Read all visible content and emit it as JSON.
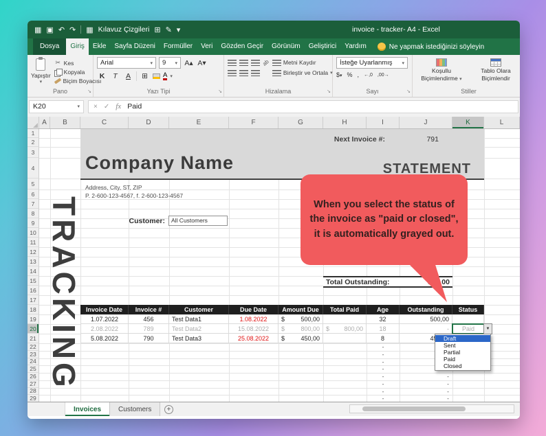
{
  "colors": {
    "accent_green": "#217346",
    "titlebar_green": "#1B5E3A",
    "callout_red": "#F15B5D",
    "overdue_red": "#E01212",
    "selection_blue": "#2C67C8",
    "grayed_text": "#ACACAC",
    "table_header_bg": "#1F1F1F"
  },
  "icons": {
    "app": "▦",
    "save": "▣",
    "undo": "↶",
    "redo": "↷",
    "gridlines": "▦",
    "table": "⊞",
    "pen": "✎",
    "dropdown": "▾",
    "dropdown_solid": "▼",
    "cut": "✂",
    "cancel": "×",
    "enter": "✓",
    "fx": "fx",
    "launcher": "↘",
    "borders": "⊞",
    "money": "$",
    "percent": "%",
    "comma": ",",
    "dec_inc": "←,0",
    "dec_dec": ",00→",
    "orient": "ab",
    "plus": "+"
  },
  "titlebar": {
    "title": "invoice - tracker- A4 - Excel",
    "gridlines_toggle": "Kılavuz Çizgileri"
  },
  "ribbon_tabs": {
    "items": [
      {
        "label": "Dosya",
        "file": true
      },
      {
        "label": "Giriş",
        "active": true
      },
      {
        "label": "Ekle"
      },
      {
        "label": "Sayfa Düzeni"
      },
      {
        "label": "Formüller"
      },
      {
        "label": "Veri"
      },
      {
        "label": "Gözden Geçir"
      },
      {
        "label": "Görünüm"
      },
      {
        "label": "Geliştirici"
      },
      {
        "label": "Yardım"
      }
    ],
    "tellme": "Ne yapmak istediğinizi söyleyin"
  },
  "ribbon": {
    "pano": {
      "paste": "Yapıştır",
      "cut": "Kes",
      "copy": "Kopyala",
      "painter": "Biçim Boyacısı",
      "label": "Pano"
    },
    "font": {
      "family": "Arial",
      "size": "9",
      "bold": "K",
      "italic": "T",
      "underline": "A",
      "color_letter": "A",
      "grow": "A▴",
      "shrink": "A▾",
      "label": "Yazı Tipi"
    },
    "alignment": {
      "wrap": "Metni Kaydır",
      "merge": "Birleştir ve Ortala",
      "label": "Hizalama"
    },
    "number": {
      "format": "İsteğe Uyarlanmış",
      "label": "Sayı"
    },
    "styles": {
      "cond_line1": "Koşullu",
      "cond_line2": "Biçimlendirme",
      "table_line1": "Tablo Olara",
      "table_line2": "Biçimlendir",
      "label": "Stiller"
    }
  },
  "formula_bar": {
    "name_box": "K20",
    "value": "Paid"
  },
  "grid": {
    "columns": [
      "A",
      "B",
      "C",
      "D",
      "E",
      "F",
      "G",
      "H",
      "I",
      "J",
      "K",
      "L"
    ],
    "rows": [
      "1",
      "2",
      "3",
      "4",
      "5",
      "6",
      "7",
      "8",
      "9",
      "10",
      "11",
      "12",
      "13",
      "14",
      "15",
      "16",
      "17",
      "18",
      "19",
      "20",
      "21",
      "22",
      "23",
      "24",
      "25",
      "26",
      "27",
      "28",
      "29"
    ],
    "selected_column": "K",
    "selected_row": "20"
  },
  "template": {
    "next_invoice_label": "Next Invoice #:",
    "next_invoice_value": "791",
    "company_name": "Company Name",
    "statement": "STATEMENT",
    "address": "Address, City, ST, ZIP",
    "phones": "P. 2-600-123-4567, f. 2-600-123-4567",
    "customer_label": "Customer:",
    "customer_value": "All Customers",
    "vertical_title": "TRACKING",
    "total_label": "Total Outstanding:",
    "total_value": "950,00",
    "currency": "$"
  },
  "invoice_table": {
    "headers": [
      "Invoice Date",
      "Invoice #",
      "Customer",
      "Due Date",
      "Amount Due",
      "Total Paid",
      "Age",
      "Outstanding",
      "Status"
    ],
    "rows": [
      {
        "date": "1.07.2022",
        "no": "456",
        "customer": "Test Data1",
        "due": "1.08.2022",
        "amount": "500,00",
        "paid": "",
        "age": "32",
        "outstanding": "500,00",
        "status": "",
        "overdue": true,
        "grayed": false
      },
      {
        "date": "2.08.2022",
        "no": "789",
        "customer": "Test Data2",
        "due": "15.08.2022",
        "amount": "800,00",
        "paid": "800,00",
        "age": "18",
        "outstanding": "-",
        "status": "Paid",
        "overdue": false,
        "grayed": true
      },
      {
        "date": "5.08.2022",
        "no": "790",
        "customer": "Test Data3",
        "due": "25.08.2022",
        "amount": "450,00",
        "paid": "",
        "age": "8",
        "outstanding": "450,00",
        "status": "",
        "overdue": true,
        "grayed": false
      }
    ],
    "empty_dash": "-",
    "empty_row_count": 8
  },
  "status_dropdown": {
    "items": [
      "Draft",
      "Sent",
      "Partial",
      "Paid",
      "Closed"
    ],
    "highlighted": "Draft"
  },
  "callout": {
    "text": "When you select the status of the invoice as \"paid or closed\", it is automatically grayed out."
  },
  "sheet_tabs": {
    "tabs": [
      {
        "label": "Invoices",
        "active": true
      },
      {
        "label": "Customers",
        "active": false
      }
    ],
    "add": "+"
  }
}
